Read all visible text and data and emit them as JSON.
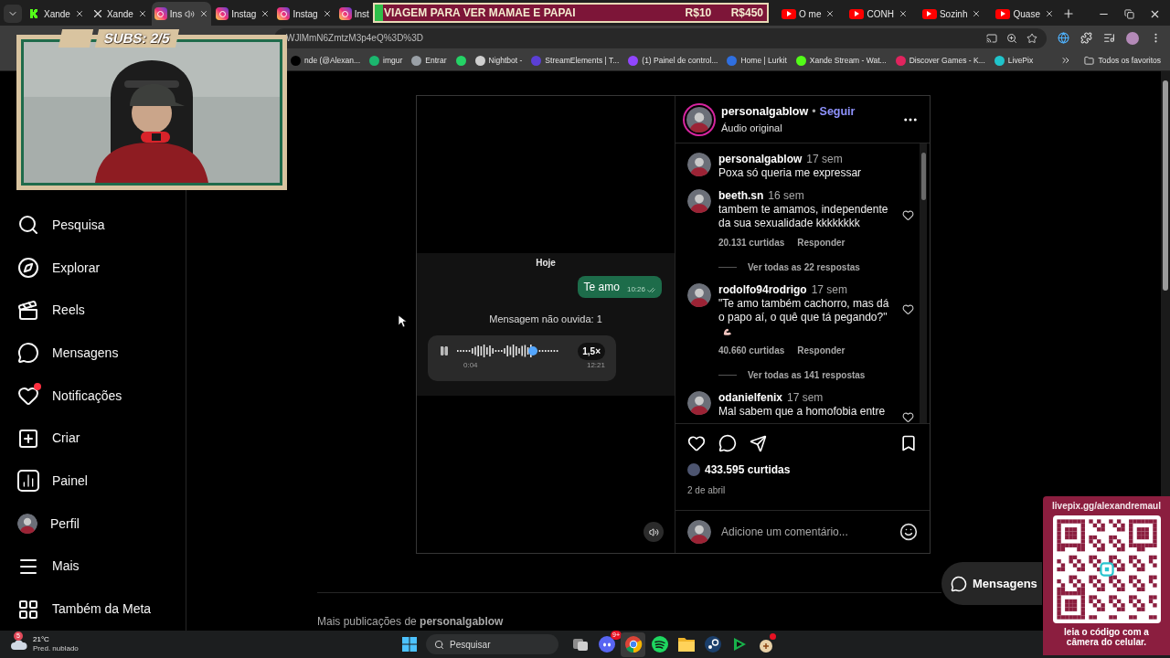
{
  "tab_strip": {
    "tabs": [
      {
        "title": "Xande",
        "kind": "kick",
        "selected": false,
        "audio": false,
        "close_shown": true
      },
      {
        "title": "Xande",
        "kind": "x",
        "selected": false,
        "audio": false,
        "close_shown": true
      },
      {
        "title": "Ins",
        "kind": "instagram",
        "selected": true,
        "audio": true,
        "close_shown": true
      },
      {
        "title": "Instag",
        "kind": "instagram",
        "selected": false,
        "audio": false,
        "close_shown": true
      },
      {
        "title": "Instag",
        "kind": "instagram",
        "selected": false,
        "audio": false,
        "close_shown": true
      },
      {
        "title": "Inst",
        "kind": "instagram",
        "selected": false,
        "audio": false,
        "close_shown": false
      }
    ],
    "tabs_right": [
      {
        "title": "O me",
        "kind": "youtube",
        "selected": false,
        "audio": false,
        "close_shown": true
      },
      {
        "title": "CONH",
        "kind": "youtube",
        "selected": false,
        "audio": false,
        "close_shown": true
      },
      {
        "title": "Sozinh",
        "kind": "youtube",
        "selected": false,
        "audio": false,
        "close_shown": true
      },
      {
        "title": "Quase",
        "kind": "youtube",
        "selected": false,
        "audio": false,
        "close_shown": true
      }
    ]
  },
  "address_bar": {
    "url": "WJlMmN6ZmtzM3p4eQ%3D%3D"
  },
  "bookmarks": [
    {
      "label": "nde (@Alexan...",
      "color": "#000000"
    },
    {
      "label": "imgur",
      "color": "#1bb76e"
    },
    {
      "label": "Entrar",
      "color": "#9aa0a6"
    },
    {
      "color": "#25d366"
    },
    {
      "label": "Nightbot -",
      "color": "#cfcfcf"
    },
    {
      "label": "StreamElements | T...",
      "color": "#5b3fd6"
    },
    {
      "label": "(1) Painel de control...",
      "color": "#9146ff"
    },
    {
      "label": "Home | Lurkit",
      "color": "#2f6fe0"
    },
    {
      "label": "Xande Stream - Wat...",
      "color": "#53fc18"
    },
    {
      "label": "Discover Games - K...",
      "color": "#e0245e"
    },
    {
      "label": "LivePix",
      "color": "#20c4cb"
    }
  ],
  "all_bookmarks": "Todos os favoritos",
  "sidebar": {
    "items": [
      {
        "label": "Pesquisa",
        "kind": "search",
        "badge": false
      },
      {
        "label": "Explorar",
        "kind": "compass",
        "badge": false
      },
      {
        "label": "Reels",
        "kind": "reels",
        "badge": false
      },
      {
        "label": "Mensagens",
        "kind": "messenger",
        "badge": false
      },
      {
        "label": "Notificações",
        "kind": "heart",
        "badge": true
      },
      {
        "label": "Criar",
        "kind": "create",
        "badge": false
      },
      {
        "label": "Painel",
        "kind": "chart",
        "badge": false
      },
      {
        "label": "Perfil",
        "kind": "avatar",
        "badge": false
      },
      {
        "label": "Mais",
        "kind": "menu",
        "badge": false
      },
      {
        "label": "Também da Meta",
        "kind": "grid",
        "badge": false
      }
    ]
  },
  "post": {
    "video": {
      "chat": {
        "date": "Hoje",
        "sent": {
          "text": "Te amo",
          "time": "10:26"
        },
        "unread": "Mensagem não ouvida: 1",
        "audio": {
          "elapsed": "0:04",
          "time": "12:21",
          "speed": "1,5×",
          "level": 0.76,
          "playing": true
        }
      }
    },
    "header": {
      "user": "personalgablow",
      "separator": "•",
      "follow": "Seguir",
      "subtitle": "Áudio original"
    },
    "comments": [
      {
        "kind": "caption",
        "user": "personalgablow",
        "time": "17 sem",
        "text": "Poxa só queria me expressar"
      },
      {
        "kind": "comment",
        "user": "beeth.sn",
        "time": "16 sem",
        "text": "tambem te amamos, independente da sua sexualidade kkkkkkkk",
        "likes": "20.131 curtidas",
        "reply": "Responder",
        "view_replies": "Ver todas as 22 respostas",
        "liked": false,
        "has_emoji": false
      },
      {
        "kind": "comment",
        "user": "rodolfo94rodrigo",
        "time": "17 sem",
        "text": "\"Te amo também cachorro, mas dá o papo aí, o quê que tá pegando?\"",
        "likes": "40.660 curtidas",
        "reply": "Responder",
        "view_replies": "Ver todas as 141 respostas",
        "liked": false,
        "has_emoji": true
      },
      {
        "kind": "comment",
        "user": "odanielfenix",
        "time": "17 sem",
        "text": "Mal sabem que a homofobia entre",
        "liked": false,
        "has_emoji": false
      }
    ],
    "likes": "433.595 curtidas",
    "date": "2 de abril",
    "liked": false,
    "saved": false,
    "comment_field": {
      "placeholder": "Adicione um comentário..."
    }
  },
  "messenger_button": {
    "label": "Mensagens"
  },
  "more_posts": "Mais publicações de **personalgablow**",
  "overlays": {
    "donation_goal": {
      "title": "VIAGEM PARA VER MAMAE E PAPAI",
      "current": "R$10",
      "goal": "R$450",
      "level": 0.02
    },
    "webcam": {
      "subs": "SUBS: 2/5"
    },
    "qr": {
      "url": "livepix.gg/alexandremaul",
      "caption": "leia o código com a câmera do celular."
    }
  },
  "taskbar": {
    "weather": {
      "temp": "21°C",
      "forecast": "Pred. nublado",
      "badge": "5"
    },
    "search": {
      "placeholder": "Pesquisar"
    },
    "apps": [
      {
        "kind": "taskview",
        "active": false,
        "alert": false
      },
      {
        "kind": "discord",
        "active": false,
        "alert": false,
        "badge": "9+"
      },
      {
        "kind": "chrome",
        "active": true,
        "alert": false
      },
      {
        "kind": "spotify",
        "active": false,
        "alert": false
      },
      {
        "kind": "files",
        "active": false,
        "alert": false
      },
      {
        "kind": "steam",
        "active": false,
        "alert": false
      },
      {
        "kind": "play",
        "active": false,
        "alert": false
      },
      {
        "kind": "bomb",
        "active": false,
        "alert": true
      }
    ]
  }
}
